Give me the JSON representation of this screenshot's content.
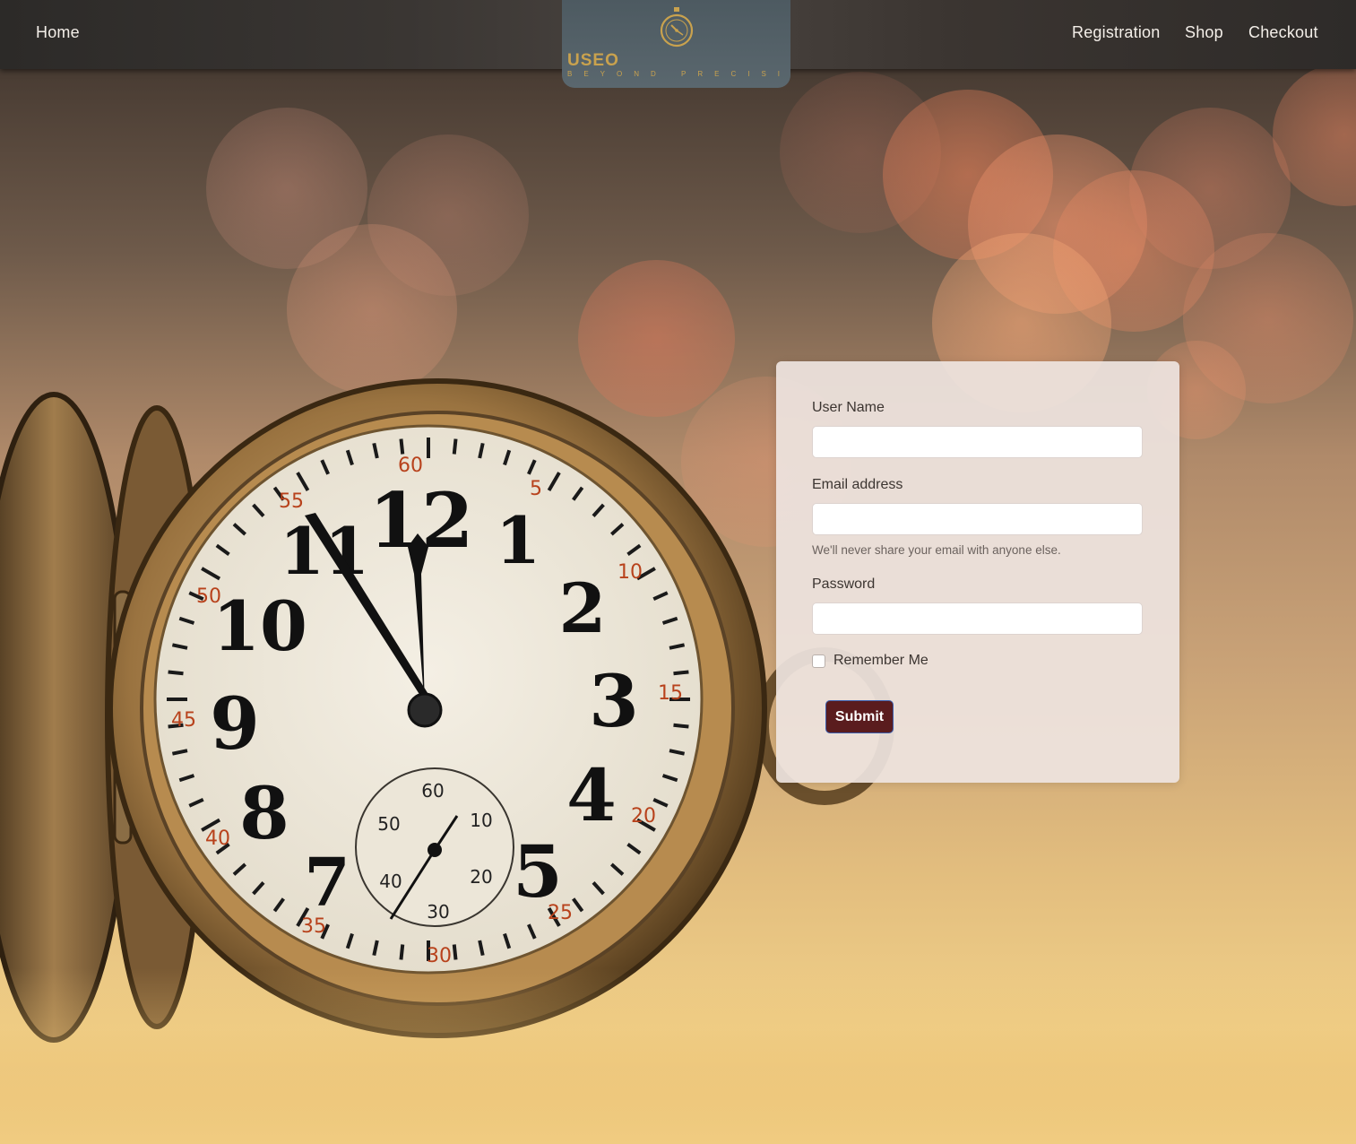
{
  "navbar": {
    "home_label": "Home",
    "right_links": [
      "Registration",
      "Shop",
      "Checkout"
    ]
  },
  "logo": {
    "brand": "USЕO",
    "tagline": "BEYOND PRECISION",
    "icon": "stopwatch-icon"
  },
  "form": {
    "username_label": "User Name",
    "username_value": "",
    "email_label": "Email address",
    "email_value": "",
    "email_help": "We'll never share your email with anyone else.",
    "password_label": "Password",
    "password_value": "",
    "remember_label": "Remember Me",
    "remember_checked": false,
    "submit_label": "Submit"
  },
  "colors": {
    "navbar": "#2f2c2a",
    "logo_bg": "#536067",
    "logo_gold": "#c9a24e",
    "submit_bg": "#5a1c1e"
  }
}
